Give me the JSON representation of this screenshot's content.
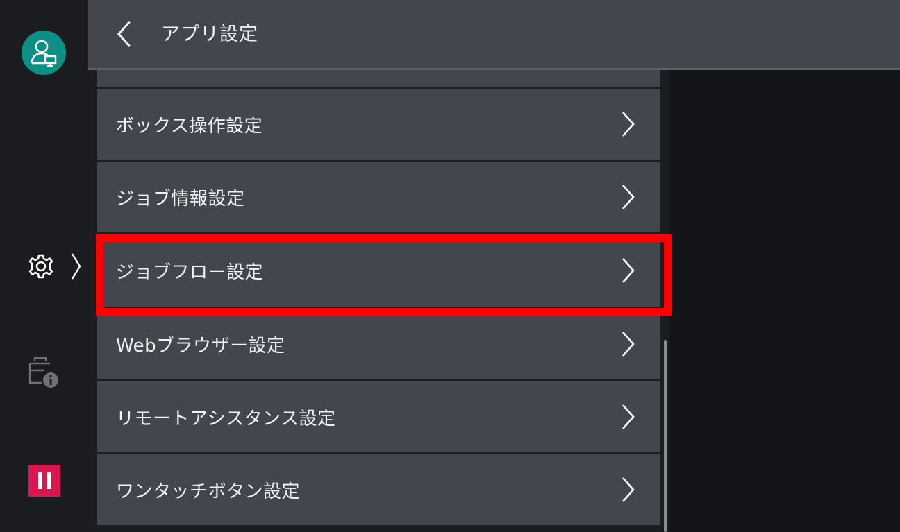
{
  "header": {
    "title": "アプリ設定"
  },
  "list": {
    "items": [
      {
        "label": ""
      },
      {
        "label": "ボックス操作設定"
      },
      {
        "label": "ジョブ情報設定"
      },
      {
        "label": "ジョブフロー設定",
        "highlighted": true
      },
      {
        "label": "Webブラウザー設定"
      },
      {
        "label": "リモートアシスタンス設定"
      },
      {
        "label": "ワンタッチボタン設定"
      }
    ]
  },
  "colors": {
    "avatar": "#0e8f86",
    "pause": "#d8174f",
    "highlight": "#ff0000",
    "row": "#44464d"
  },
  "icons": {
    "back": "chevron-left-icon",
    "row_arrow": "chevron-right-icon",
    "avatar": "user-computer-icon",
    "settings": "gear-icon",
    "device_info": "printer-info-icon",
    "pause": "pause-icon"
  }
}
